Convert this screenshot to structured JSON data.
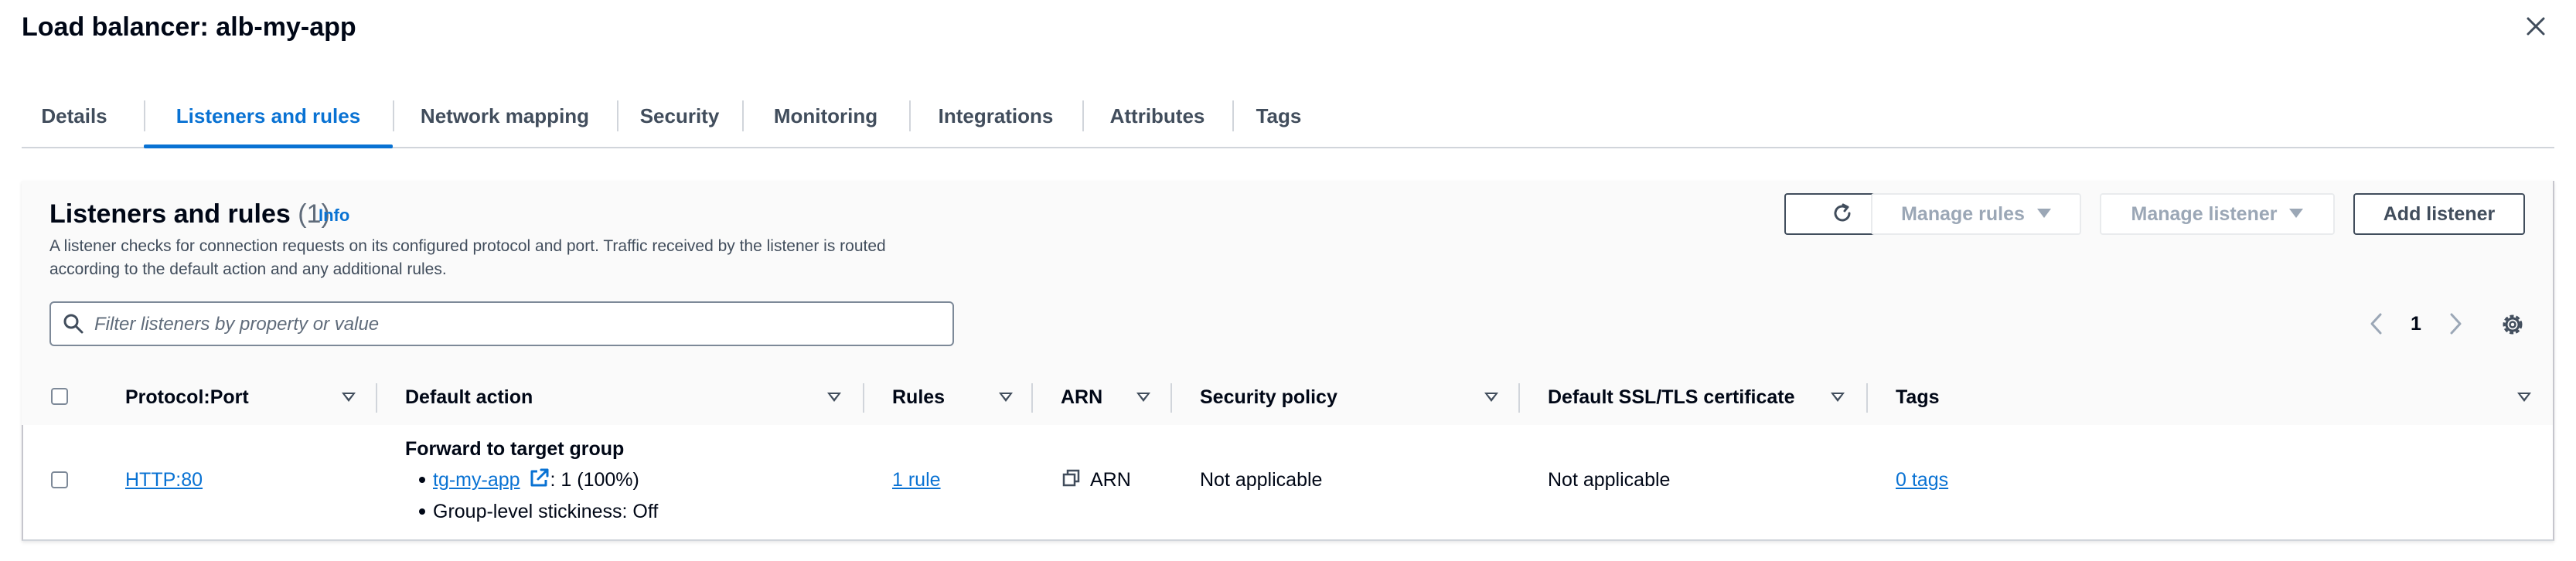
{
  "header": {
    "title": "Load balancer: alb-my-app"
  },
  "tabs": [
    {
      "label": "Details"
    },
    {
      "label": "Listeners and rules"
    },
    {
      "label": "Network mapping"
    },
    {
      "label": "Security"
    },
    {
      "label": "Monitoring"
    },
    {
      "label": "Integrations"
    },
    {
      "label": "Attributes"
    },
    {
      "label": "Tags"
    }
  ],
  "active_tab": "Listeners and rules",
  "section": {
    "title": "Listeners and rules",
    "count": "(1)",
    "info_label": "Info",
    "description_line1": "A listener checks for connection requests on its configured protocol and port. Traffic received by the listener is routed",
    "description_line2": "according to the default action and any additional rules."
  },
  "toolbar": {
    "manage_rules_label": "Manage rules",
    "manage_listener_label": "Manage listener",
    "add_listener_label": "Add listener"
  },
  "search": {
    "placeholder": "Filter listeners by property or value",
    "value": ""
  },
  "pagination": {
    "current_page": "1"
  },
  "table": {
    "columns": [
      {
        "label": "Protocol:Port"
      },
      {
        "label": "Default action"
      },
      {
        "label": "Rules"
      },
      {
        "label": "ARN"
      },
      {
        "label": "Security policy"
      },
      {
        "label": "Default SSL/TLS certificate"
      },
      {
        "label": "Tags"
      }
    ],
    "rows": [
      {
        "protocol_port": "HTTP:80",
        "default_action_title": "Forward to target group",
        "target_group": "tg-my-app",
        "target_weight": ": 1 (100%)",
        "stickiness": "Group-level stickiness: Off",
        "rules": "1 rule",
        "arn": "ARN",
        "security_policy": "Not applicable",
        "ssl_certificate": "Not applicable",
        "tags": "0 tags"
      }
    ]
  },
  "colors": {
    "link": "#0972d3",
    "text": "#000716",
    "disabled": "#9ba7b6"
  }
}
